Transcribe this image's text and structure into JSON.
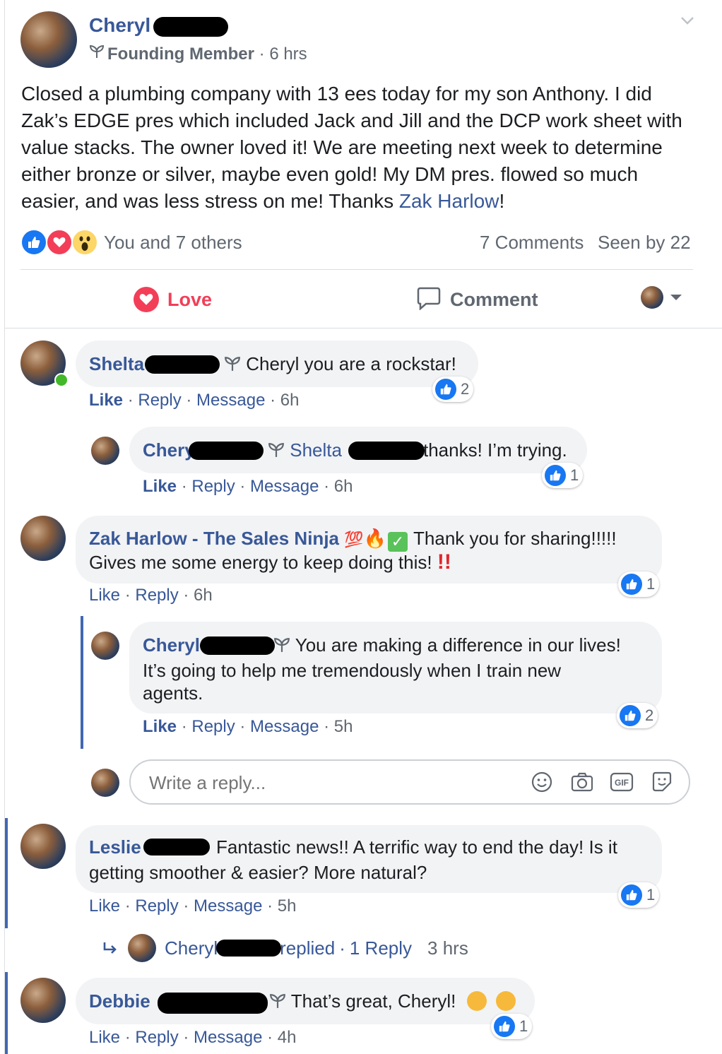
{
  "post": {
    "author": "Cheryl",
    "badge": "Founding Member",
    "time": "· 6 hrs",
    "body_text": "Closed a plumbing company with 13 ees today for my son Anthony. I did Zak’s EDGE pres which included Jack and Jill and the DCP work sheet with value stacks. The owner loved it! We are meeting next week to determine either bronze or silver, maybe even gold! My DM pres. flowed so much easier, and was less stress on me! Thanks ",
    "mention": "Zak Harlow",
    "body_end": "!",
    "reactions_text": "You and 7 others",
    "comments_count": "7 Comments",
    "seen_by": "Seen by 22"
  },
  "actions": {
    "love": "Love",
    "comment": "Comment"
  },
  "comments": [
    {
      "name": "Shelta",
      "text": "Cheryl you are a rockstar!",
      "like": "Like",
      "reply": "Reply",
      "message": "Message",
      "time": "6h",
      "reactions": "2"
    },
    {
      "name": "Chery",
      "mention": "Shelta",
      "text": "thanks! I’m trying.",
      "like": "Like",
      "reply": "Reply",
      "message": "Message",
      "time": "6h",
      "reactions": "1"
    },
    {
      "name": "Zak Harlow - The Sales Ninja",
      "emoji": "💯",
      "text": "Thank you for sharing!!!!!",
      "text2": "Gives me some energy to keep doing this!",
      "like": "Like",
      "reply": "Reply",
      "time": "6h",
      "reactions": "1"
    },
    {
      "name": "Cheryl",
      "text": "You are making a difference in our lives!",
      "text2": "It’s going to help me tremendously when I train new",
      "text3": "agents.",
      "like": "Like",
      "reply": "Reply",
      "message": "Message",
      "time": "5h",
      "reactions": "2"
    },
    {
      "name": "Leslie",
      "text": "Fantastic news!! A terrific way to end the day! Is it",
      "text2": "getting smoother & easier? More natural?",
      "like": "Like",
      "reply": "Reply",
      "message": "Message",
      "time": "5h",
      "reactions": "1"
    },
    {
      "name": "Debbie",
      "text": "That’s great, Cheryl!",
      "like": "Like",
      "reply": "Reply",
      "message": "Message",
      "time": "4h",
      "reactions": "1"
    }
  ],
  "reply_box": {
    "placeholder": "Write a reply..."
  },
  "replied": {
    "name": "Cheryl",
    "text": "replied",
    "count": "1 Reply",
    "time": "3 hrs"
  },
  "icons": {
    "menu": "chevron-down-icon",
    "badge": "sprout-icon",
    "like": "like-reaction-icon",
    "heart": "love-reaction-icon",
    "wow": "wow-reaction-icon",
    "comment": "comment-bubble-icon",
    "emoji": "emoji-icon",
    "camera": "camera-icon",
    "gif": "gif-icon",
    "sticker": "sticker-icon",
    "reply_arrow": "reply-arrow-icon"
  },
  "colors": {
    "link": "#385898",
    "like_blue": "#1877f2",
    "love_red": "#f33e58",
    "bubble": "#f2f3f5"
  }
}
